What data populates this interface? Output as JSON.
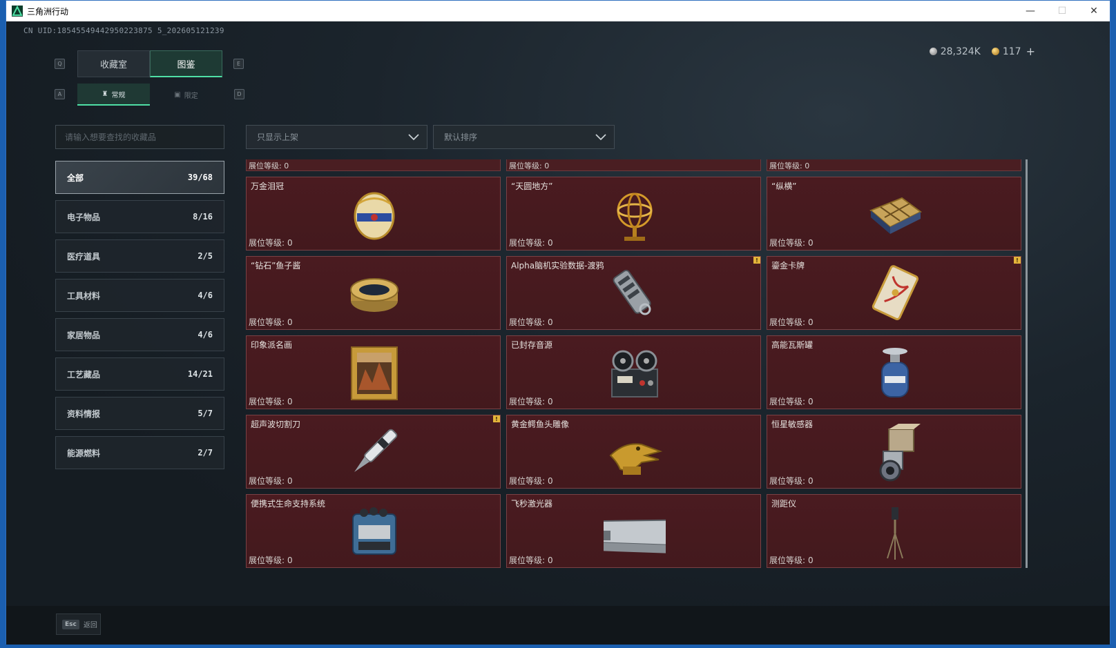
{
  "window": {
    "title": "三角洲行动",
    "controls": {
      "minimize": "—",
      "maximize": "☐",
      "close": "✕"
    }
  },
  "uid": "CN UID:18545549442950223875 5_202605121239",
  "currency": {
    "silver": "28,324K",
    "gold": "117",
    "plus": "+"
  },
  "hotkeys": {
    "tab_left": "Q",
    "tab_right": "E",
    "sub_left": "A",
    "sub_right": "D"
  },
  "tabs": [
    {
      "label": "收藏室"
    },
    {
      "label": "图鉴"
    }
  ],
  "subtabs": [
    {
      "label": "常规",
      "icon": "♜"
    },
    {
      "label": "限定",
      "icon": "▣"
    }
  ],
  "search": {
    "placeholder": "请输入想要查找的收藏品"
  },
  "categories": [
    {
      "label": "全部",
      "count": "39/68"
    },
    {
      "label": "电子物品",
      "count": "8/16"
    },
    {
      "label": "医疗道具",
      "count": "2/5"
    },
    {
      "label": "工具材料",
      "count": "4/6"
    },
    {
      "label": "家居物品",
      "count": "4/6"
    },
    {
      "label": "工艺藏品",
      "count": "14/21"
    },
    {
      "label": "资料情报",
      "count": "5/7"
    },
    {
      "label": "能源燃料",
      "count": "2/7"
    }
  ],
  "filters": {
    "shelf": "只显示上架",
    "sort": "默认排序"
  },
  "level_label": "展位等级:",
  "partial_levels": [
    "0",
    "0",
    "0"
  ],
  "items": [
    {
      "name": "万金泪冠",
      "level": "0",
      "icon": "jeweled-egg-icon",
      "badge": false
    },
    {
      "name": "“天圆地方”",
      "level": "0",
      "icon": "armillary-sphere-icon",
      "badge": false
    },
    {
      "name": "“纵横”",
      "level": "0",
      "icon": "chess-box-icon",
      "badge": false
    },
    {
      "name": "“钻石”鱼子酱",
      "level": "0",
      "icon": "caviar-tin-icon",
      "badge": false
    },
    {
      "name": "Alpha脑机实验数据-渡鸦",
      "level": "0",
      "icon": "data-drive-icon",
      "badge": true
    },
    {
      "name": "鎏金卡牌",
      "level": "0",
      "icon": "gilded-card-icon",
      "badge": true
    },
    {
      "name": "印象派名画",
      "level": "0",
      "icon": "framed-painting-icon",
      "badge": false
    },
    {
      "name": "已封存音源",
      "level": "0",
      "icon": "reel-recorder-icon",
      "badge": false
    },
    {
      "name": "高能瓦斯罐",
      "level": "0",
      "icon": "gas-canister-icon",
      "badge": false
    },
    {
      "name": "超声波切割刀",
      "level": "0",
      "icon": "ultrasonic-knife-icon",
      "badge": true
    },
    {
      "name": "黄金鳄鱼头雕像",
      "level": "0",
      "icon": "gold-crocodile-icon",
      "badge": false
    },
    {
      "name": "恒星敏感器",
      "level": "0",
      "icon": "star-sensor-icon",
      "badge": false
    },
    {
      "name": "便携式生命支持系统",
      "level": "0",
      "icon": "life-support-icon",
      "badge": false
    },
    {
      "name": "飞秒激光器",
      "level": "0",
      "icon": "femtosecond-laser-icon",
      "badge": false
    },
    {
      "name": "测距仪",
      "level": "0",
      "icon": "rangefinder-icon",
      "badge": false
    }
  ],
  "badge_mark": "!",
  "back": {
    "key": "Esc",
    "label": "返回"
  },
  "colors": {
    "accent": "#4fe0a6",
    "card": "#4a1b20",
    "card_border": "#7a4145",
    "badge": "#e3b43a"
  }
}
